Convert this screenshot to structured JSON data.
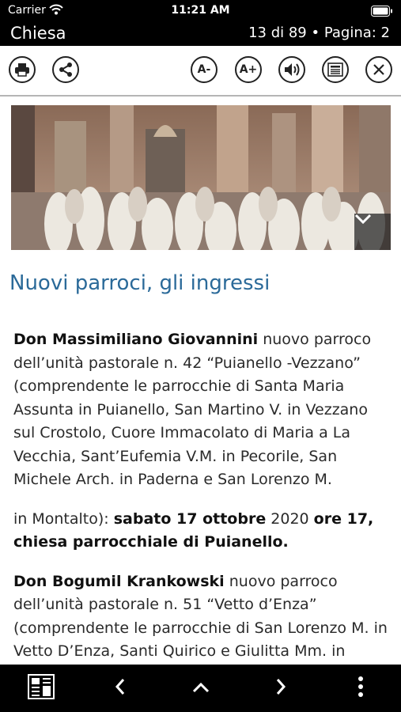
{
  "status": {
    "carrier": "Carrier",
    "time": "11:21 AM"
  },
  "header": {
    "title": "Chiesa",
    "pager": "13 di 89 • Pagina: 2"
  },
  "toolbar": {
    "font_decrease": "A-",
    "font_increase": "A+"
  },
  "article": {
    "title": "Nuovi parroci, gli ingressi",
    "p1_name": "Don Massimiliano Giovannini",
    "p1_text": " nuovo parroco dell’unità pastorale n. 42 “Puianello -Vezzano” (comprendente le parrocchie di Santa Maria Assunta in Puianello, San Martino V. in Vezzano sul Crostolo, Cuore Immacolato di Maria a La Vecchia, Sant’Eufemia V.M. in Pecorile, San Michele Arch. in Paderna e San Lorenzo M.",
    "p2_text_a": "in Montalto): ",
    "p2_bold_a": "sabato 17 ottobre",
    "p2_text_b": " 2020 ",
    "p2_bold_b": "ore 17, chiesa parrocchiale di Puianello.",
    "p3_name": "Don Bogumil Krankowski",
    "p3_text": " nuovo parroco dell’unità pastorale n. 51 “Vetto d’Enza” (comprendente le parrocchie di San Lorenzo M. in Vetto D’Enza, Santi Quirico e Giulitta Mm. in"
  },
  "icons": {
    "print": "printer-icon",
    "share": "share-icon",
    "speaker": "speaker-icon",
    "reader": "newspaper-icon",
    "close": "close-icon",
    "chevron": "chevron-down-icon",
    "nav_pages": "newspaper-pages-icon",
    "prev": "chevron-left-icon",
    "up": "chevron-up-icon",
    "next": "chevron-right-icon",
    "more": "more-vertical-icon"
  }
}
